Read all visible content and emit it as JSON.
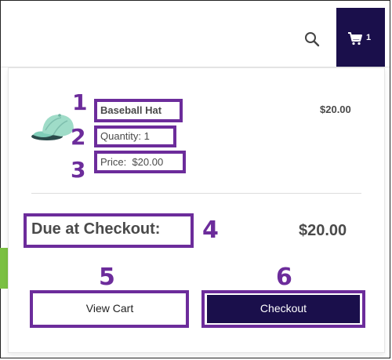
{
  "header": {
    "search_icon": "search-icon",
    "cart_icon": "shopping-cart-icon",
    "cart_count": "1"
  },
  "item": {
    "name": "Baseball Hat",
    "quantity": "Quantity: 1",
    "price": "Price:  $20.00",
    "line_total": "$20.00",
    "image_icon": "baseball-hat-image"
  },
  "summary": {
    "due_label": "Due at Checkout:",
    "due_amount": "$20.00"
  },
  "actions": {
    "view_cart": "View Cart",
    "checkout": "Checkout"
  },
  "callouts": [
    "1",
    "2",
    "3",
    "4",
    "5",
    "6"
  ],
  "colors": {
    "brand_navy": "#1a0f4b",
    "callout_purple": "#6c2c9b",
    "text": "#4a4a4a"
  }
}
